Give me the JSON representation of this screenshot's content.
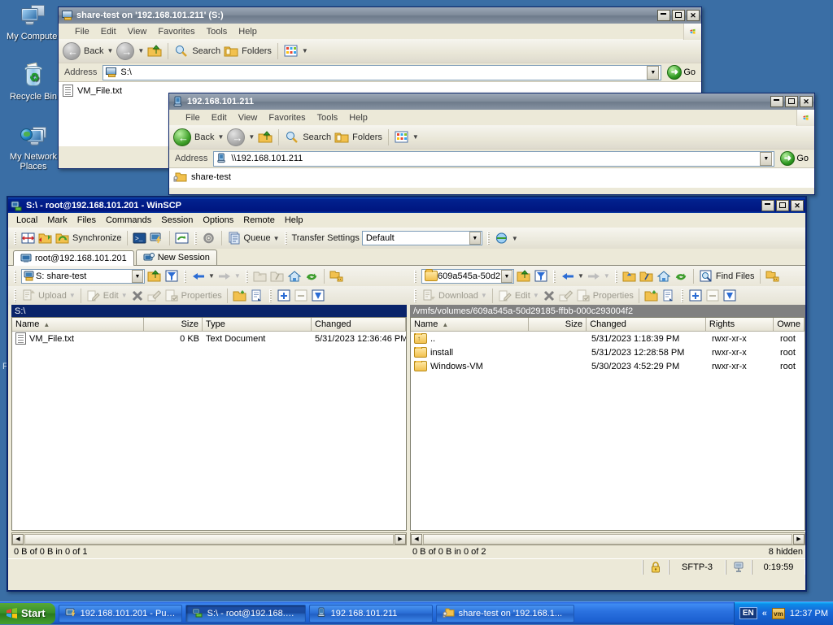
{
  "desktop": {
    "icons": [
      {
        "name": "my-computer",
        "label": "My Computer"
      },
      {
        "name": "recycle-bin",
        "label": "Recycle Bin"
      },
      {
        "name": "my-network-places",
        "label": "My Network\nPlaces"
      }
    ],
    "stray_text": "F"
  },
  "explorer_share": {
    "title": "share-test on '192.168.101.211' (S:)",
    "menu": [
      "File",
      "Edit",
      "View",
      "Favorites",
      "Tools",
      "Help"
    ],
    "toolbar": {
      "back": "Back",
      "search": "Search",
      "folders": "Folders",
      "views_icon": "views-icon"
    },
    "address": {
      "label": "Address",
      "value": "S:\\",
      "go": "Go"
    },
    "items": [
      {
        "name": "VM_File.txt",
        "icon": "text-document-icon"
      }
    ],
    "buttons": {
      "minimize": "_",
      "maximize": "[]",
      "close": "X"
    }
  },
  "explorer_server": {
    "title": "192.168.101.211",
    "menu": [
      "File",
      "Edit",
      "View",
      "Favorites",
      "Tools",
      "Help"
    ],
    "toolbar": {
      "back": "Back",
      "search": "Search",
      "folders": "Folders"
    },
    "address": {
      "label": "Address",
      "value": "\\\\192.168.101.211",
      "go": "Go"
    },
    "items": [
      {
        "name": "share-test",
        "icon": "shared-folder-icon"
      }
    ]
  },
  "winscp": {
    "title": "S:\\ - root@192.168.101.201 - WinSCP",
    "menu": [
      "Local",
      "Mark",
      "Files",
      "Commands",
      "Session",
      "Options",
      "Remote",
      "Help"
    ],
    "toolbar": {
      "synchronize": "Synchronize",
      "queue": "Queue",
      "transfer_settings_label": "Transfer Settings",
      "transfer_settings_value": "Default"
    },
    "tabs": [
      {
        "label": "root@192.168.101.201",
        "selected": true,
        "icon": "session-icon"
      },
      {
        "label": "New Session",
        "selected": false,
        "icon": "new-session-icon"
      }
    ],
    "local": {
      "drive_combo": "S: share-test",
      "path": "S:\\",
      "actions": [
        "Upload",
        "Edit",
        "Properties"
      ],
      "columns": [
        "Name",
        "Size",
        "Type",
        "Changed"
      ],
      "rows": [
        {
          "name": "VM_File.txt",
          "size": "0 KB",
          "type": "Text Document",
          "changed": "5/31/2023  12:36:46 PM",
          "icon": "text-document-icon"
        }
      ],
      "status": "0 B of 0 B in 0 of 1"
    },
    "remote": {
      "dir_combo": "609a545a-50d2",
      "path": "/vmfs/volumes/609a545a-50d29185-ffbb-000c293004f2",
      "find_files": "Find Files",
      "actions": [
        "Download",
        "Edit",
        "Properties"
      ],
      "columns": [
        "Name",
        "Size",
        "Changed",
        "Rights",
        "Owne"
      ],
      "rows": [
        {
          "name": "..",
          "size": "",
          "changed": "5/31/2023 1:18:39 PM",
          "rights": "rwxr-xr-x",
          "owner": "root",
          "icon": "parent-folder-icon"
        },
        {
          "name": "install",
          "size": "",
          "changed": "5/31/2023 12:28:58 PM",
          "rights": "rwxr-xr-x",
          "owner": "root",
          "icon": "folder-icon"
        },
        {
          "name": "Windows-VM",
          "size": "",
          "changed": "5/30/2023 4:52:29 PM",
          "rights": "rwxr-xr-x",
          "owner": "root",
          "icon": "folder-icon"
        }
      ],
      "status": "0 B of 0 B in 0 of 2",
      "hidden": "8 hidden"
    },
    "statusbar": {
      "protocol": "SFTP-3",
      "time": "0:19:59",
      "lock_icon": "padlock-icon",
      "session_icon": "session-indicator-icon"
    }
  },
  "taskbar": {
    "start": "Start",
    "tasks": [
      {
        "label": "192.168.101.201 - PuTTY",
        "active": false,
        "icon": "putty-icon"
      },
      {
        "label": "S:\\ - root@192.168.10...",
        "active": true,
        "icon": "winscp-icon"
      },
      {
        "label": "192.168.101.211",
        "active": false,
        "icon": "explorer-icon"
      },
      {
        "label": "share-test on '192.168.1...",
        "active": false,
        "icon": "share-icon"
      }
    ],
    "tray": {
      "language": "EN",
      "chevron": "«",
      "vm_icon": "vm-tools-icon",
      "clock": "12:37 PM"
    }
  },
  "colors": {
    "desktop": "#3a6ea5",
    "active_title": "#00157f",
    "inactive_title": "#7d8998",
    "face": "#ece9d8",
    "taskbar": "#245edb"
  }
}
